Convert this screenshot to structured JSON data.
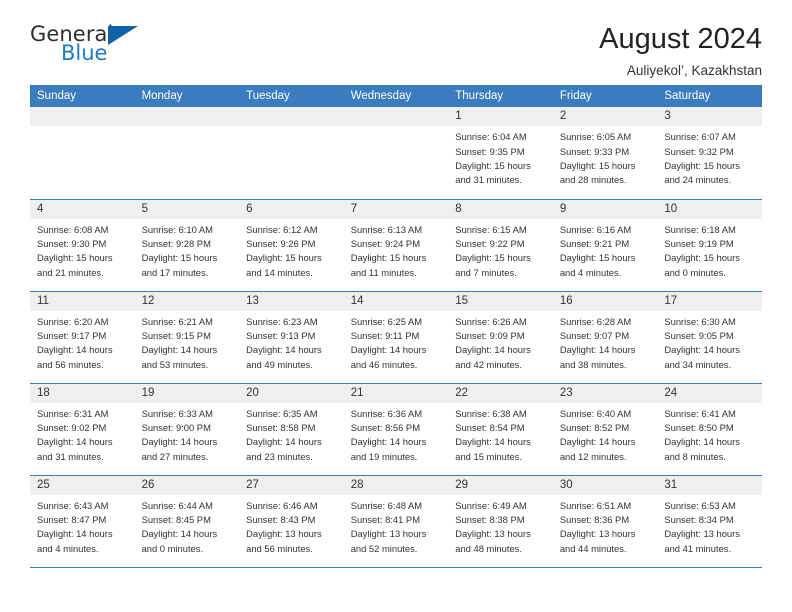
{
  "brand": {
    "name_part1": "General",
    "name_part2": "Blue",
    "triangle_color": "#1261a8",
    "blue_color": "#1d7cc4"
  },
  "header": {
    "title": "August 2024",
    "subtitle": "Auliyekol’, Kazakhstan",
    "accent_color": "#3a7cbe",
    "band_color": "#efefef"
  },
  "weekday_headers": [
    "Sunday",
    "Monday",
    "Tuesday",
    "Wednesday",
    "Thursday",
    "Friday",
    "Saturday"
  ],
  "weeks": [
    [
      {
        "day": "",
        "sunrise": "",
        "sunset": "",
        "daylight_line1": "",
        "daylight_line2": ""
      },
      {
        "day": "",
        "sunrise": "",
        "sunset": "",
        "daylight_line1": "",
        "daylight_line2": ""
      },
      {
        "day": "",
        "sunrise": "",
        "sunset": "",
        "daylight_line1": "",
        "daylight_line2": ""
      },
      {
        "day": "",
        "sunrise": "",
        "sunset": "",
        "daylight_line1": "",
        "daylight_line2": ""
      },
      {
        "day": "1",
        "sunrise": "Sunrise: 6:04 AM",
        "sunset": "Sunset: 9:35 PM",
        "daylight_line1": "Daylight: 15 hours",
        "daylight_line2": "and 31 minutes."
      },
      {
        "day": "2",
        "sunrise": "Sunrise: 6:05 AM",
        "sunset": "Sunset: 9:33 PM",
        "daylight_line1": "Daylight: 15 hours",
        "daylight_line2": "and 28 minutes."
      },
      {
        "day": "3",
        "sunrise": "Sunrise: 6:07 AM",
        "sunset": "Sunset: 9:32 PM",
        "daylight_line1": "Daylight: 15 hours",
        "daylight_line2": "and 24 minutes."
      }
    ],
    [
      {
        "day": "4",
        "sunrise": "Sunrise: 6:08 AM",
        "sunset": "Sunset: 9:30 PM",
        "daylight_line1": "Daylight: 15 hours",
        "daylight_line2": "and 21 minutes."
      },
      {
        "day": "5",
        "sunrise": "Sunrise: 6:10 AM",
        "sunset": "Sunset: 9:28 PM",
        "daylight_line1": "Daylight: 15 hours",
        "daylight_line2": "and 17 minutes."
      },
      {
        "day": "6",
        "sunrise": "Sunrise: 6:12 AM",
        "sunset": "Sunset: 9:26 PM",
        "daylight_line1": "Daylight: 15 hours",
        "daylight_line2": "and 14 minutes."
      },
      {
        "day": "7",
        "sunrise": "Sunrise: 6:13 AM",
        "sunset": "Sunset: 9:24 PM",
        "daylight_line1": "Daylight: 15 hours",
        "daylight_line2": "and 11 minutes."
      },
      {
        "day": "8",
        "sunrise": "Sunrise: 6:15 AM",
        "sunset": "Sunset: 9:22 PM",
        "daylight_line1": "Daylight: 15 hours",
        "daylight_line2": "and 7 minutes."
      },
      {
        "day": "9",
        "sunrise": "Sunrise: 6:16 AM",
        "sunset": "Sunset: 9:21 PM",
        "daylight_line1": "Daylight: 15 hours",
        "daylight_line2": "and 4 minutes."
      },
      {
        "day": "10",
        "sunrise": "Sunrise: 6:18 AM",
        "sunset": "Sunset: 9:19 PM",
        "daylight_line1": "Daylight: 15 hours",
        "daylight_line2": "and 0 minutes."
      }
    ],
    [
      {
        "day": "11",
        "sunrise": "Sunrise: 6:20 AM",
        "sunset": "Sunset: 9:17 PM",
        "daylight_line1": "Daylight: 14 hours",
        "daylight_line2": "and 56 minutes."
      },
      {
        "day": "12",
        "sunrise": "Sunrise: 6:21 AM",
        "sunset": "Sunset: 9:15 PM",
        "daylight_line1": "Daylight: 14 hours",
        "daylight_line2": "and 53 minutes."
      },
      {
        "day": "13",
        "sunrise": "Sunrise: 6:23 AM",
        "sunset": "Sunset: 9:13 PM",
        "daylight_line1": "Daylight: 14 hours",
        "daylight_line2": "and 49 minutes."
      },
      {
        "day": "14",
        "sunrise": "Sunrise: 6:25 AM",
        "sunset": "Sunset: 9:11 PM",
        "daylight_line1": "Daylight: 14 hours",
        "daylight_line2": "and 46 minutes."
      },
      {
        "day": "15",
        "sunrise": "Sunrise: 6:26 AM",
        "sunset": "Sunset: 9:09 PM",
        "daylight_line1": "Daylight: 14 hours",
        "daylight_line2": "and 42 minutes."
      },
      {
        "day": "16",
        "sunrise": "Sunrise: 6:28 AM",
        "sunset": "Sunset: 9:07 PM",
        "daylight_line1": "Daylight: 14 hours",
        "daylight_line2": "and 38 minutes."
      },
      {
        "day": "17",
        "sunrise": "Sunrise: 6:30 AM",
        "sunset": "Sunset: 9:05 PM",
        "daylight_line1": "Daylight: 14 hours",
        "daylight_line2": "and 34 minutes."
      }
    ],
    [
      {
        "day": "18",
        "sunrise": "Sunrise: 6:31 AM",
        "sunset": "Sunset: 9:02 PM",
        "daylight_line1": "Daylight: 14 hours",
        "daylight_line2": "and 31 minutes."
      },
      {
        "day": "19",
        "sunrise": "Sunrise: 6:33 AM",
        "sunset": "Sunset: 9:00 PM",
        "daylight_line1": "Daylight: 14 hours",
        "daylight_line2": "and 27 minutes."
      },
      {
        "day": "20",
        "sunrise": "Sunrise: 6:35 AM",
        "sunset": "Sunset: 8:58 PM",
        "daylight_line1": "Daylight: 14 hours",
        "daylight_line2": "and 23 minutes."
      },
      {
        "day": "21",
        "sunrise": "Sunrise: 6:36 AM",
        "sunset": "Sunset: 8:56 PM",
        "daylight_line1": "Daylight: 14 hours",
        "daylight_line2": "and 19 minutes."
      },
      {
        "day": "22",
        "sunrise": "Sunrise: 6:38 AM",
        "sunset": "Sunset: 8:54 PM",
        "daylight_line1": "Daylight: 14 hours",
        "daylight_line2": "and 15 minutes."
      },
      {
        "day": "23",
        "sunrise": "Sunrise: 6:40 AM",
        "sunset": "Sunset: 8:52 PM",
        "daylight_line1": "Daylight: 14 hours",
        "daylight_line2": "and 12 minutes."
      },
      {
        "day": "24",
        "sunrise": "Sunrise: 6:41 AM",
        "sunset": "Sunset: 8:50 PM",
        "daylight_line1": "Daylight: 14 hours",
        "daylight_line2": "and 8 minutes."
      }
    ],
    [
      {
        "day": "25",
        "sunrise": "Sunrise: 6:43 AM",
        "sunset": "Sunset: 8:47 PM",
        "daylight_line1": "Daylight: 14 hours",
        "daylight_line2": "and 4 minutes."
      },
      {
        "day": "26",
        "sunrise": "Sunrise: 6:44 AM",
        "sunset": "Sunset: 8:45 PM",
        "daylight_line1": "Daylight: 14 hours",
        "daylight_line2": "and 0 minutes."
      },
      {
        "day": "27",
        "sunrise": "Sunrise: 6:46 AM",
        "sunset": "Sunset: 8:43 PM",
        "daylight_line1": "Daylight: 13 hours",
        "daylight_line2": "and 56 minutes."
      },
      {
        "day": "28",
        "sunrise": "Sunrise: 6:48 AM",
        "sunset": "Sunset: 8:41 PM",
        "daylight_line1": "Daylight: 13 hours",
        "daylight_line2": "and 52 minutes."
      },
      {
        "day": "29",
        "sunrise": "Sunrise: 6:49 AM",
        "sunset": "Sunset: 8:38 PM",
        "daylight_line1": "Daylight: 13 hours",
        "daylight_line2": "and 48 minutes."
      },
      {
        "day": "30",
        "sunrise": "Sunrise: 6:51 AM",
        "sunset": "Sunset: 8:36 PM",
        "daylight_line1": "Daylight: 13 hours",
        "daylight_line2": "and 44 minutes."
      },
      {
        "day": "31",
        "sunrise": "Sunrise: 6:53 AM",
        "sunset": "Sunset: 8:34 PM",
        "daylight_line1": "Daylight: 13 hours",
        "daylight_line2": "and 41 minutes."
      }
    ]
  ]
}
